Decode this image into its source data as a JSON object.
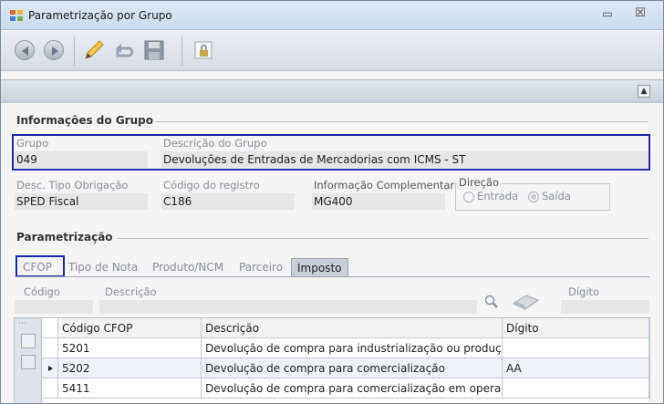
{
  "window": {
    "title": "Parametrização por Grupo",
    "minimize_symbol": "▭",
    "close_symbol": "☒"
  },
  "toolbar": {
    "buttons": [
      {
        "name": "back-icon"
      },
      {
        "name": "forward-icon"
      },
      {
        "name": "pencil-icon"
      },
      {
        "name": "undo-icon"
      },
      {
        "name": "save-icon"
      },
      {
        "name": "lock-icon"
      }
    ]
  },
  "collapse_symbol": "▲",
  "info": {
    "section_title": "Informações do Grupo",
    "grupo_label": "Grupo",
    "grupo_value": "049",
    "descricao_label": "Descrição do Grupo",
    "descricao_value": "Devoluções de Entradas de Mercadorias com ICMS - ST",
    "tipo_label": "Desc. Tipo Obrigação",
    "tipo_value": "SPED Fiscal",
    "codigo_label": "Código do registro",
    "codigo_value": "C186",
    "info_label": "Informação Complementar",
    "info_value": "MG400",
    "direcao_label": "Direção",
    "entrada_label": "Entrada",
    "saida_label": "Saída",
    "direcao_selected": "Saída"
  },
  "param": {
    "section_title": "Parametrização",
    "tabs": [
      "CFOP",
      "Tipo de Nota",
      "Produto/NCM",
      "Parceiro",
      "Imposto"
    ],
    "active_tab": "Imposto",
    "filter": {
      "codigo_label": "Código",
      "descricao_label": "Descrição",
      "digito_label": "Dígito"
    },
    "grid": {
      "columns": [
        "Código CFOP",
        "Descrição",
        "Dígito"
      ],
      "rows": [
        {
          "codigo": "5201",
          "descricao": "Devolução de compra para industrialização ou produçã...",
          "digito": ""
        },
        {
          "codigo": "5202",
          "descricao": "Devolução de compra para comercialização",
          "digito": "AA",
          "selected": true
        },
        {
          "codigo": "5411",
          "descricao": "Devolução de compra para comercialização em operaçã...",
          "digito": ""
        }
      ]
    }
  }
}
